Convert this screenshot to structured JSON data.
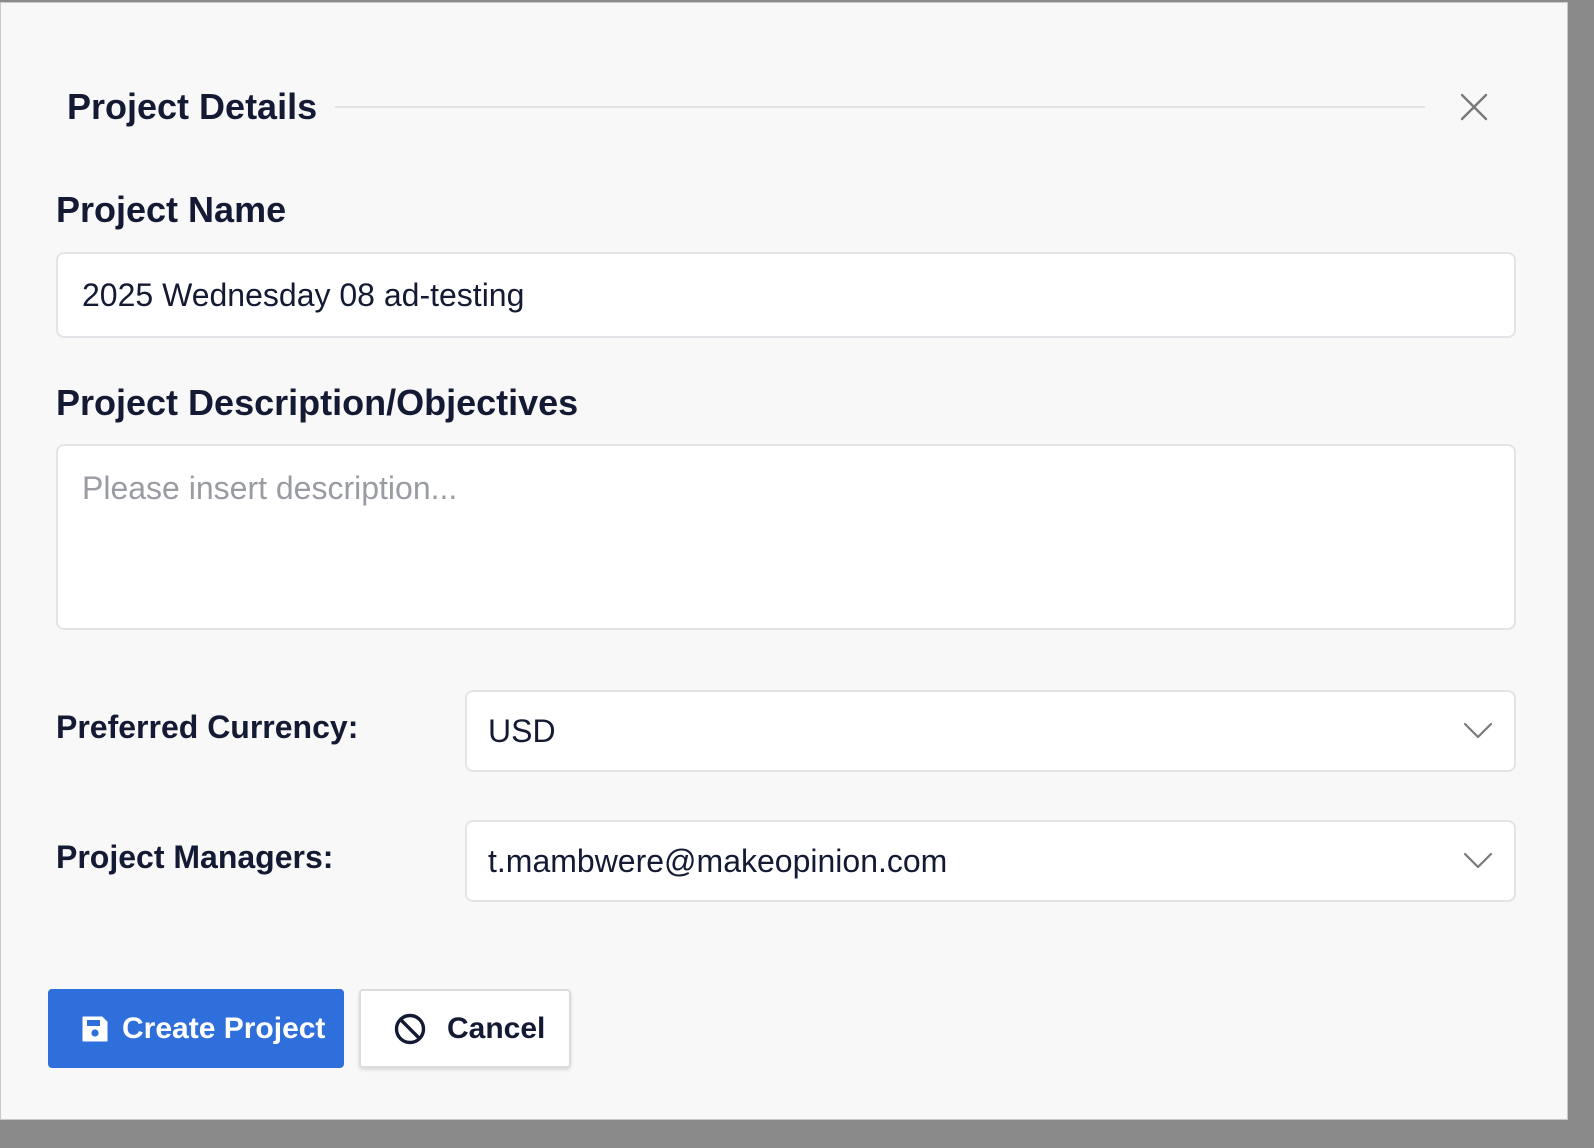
{
  "dialog": {
    "title": "Project Details",
    "close_icon": "close-icon"
  },
  "form": {
    "project_name": {
      "label": "Project Name",
      "value": "2025 Wednesday 08 ad-testing"
    },
    "description": {
      "label": "Project Description/Objectives",
      "value": "",
      "placeholder": "Please insert description..."
    },
    "currency": {
      "label": "Preferred Currency:",
      "selected": "USD"
    },
    "managers": {
      "label": "Project Managers:",
      "selected": "t.mambwere@makeopinion.com"
    }
  },
  "actions": {
    "create_label": "Create Project",
    "create_icon": "save-icon",
    "cancel_label": "Cancel",
    "cancel_icon": "ban-icon"
  },
  "colors": {
    "primary": "#2f6fdb",
    "text": "#141a33",
    "background": "#f8f8f8"
  }
}
